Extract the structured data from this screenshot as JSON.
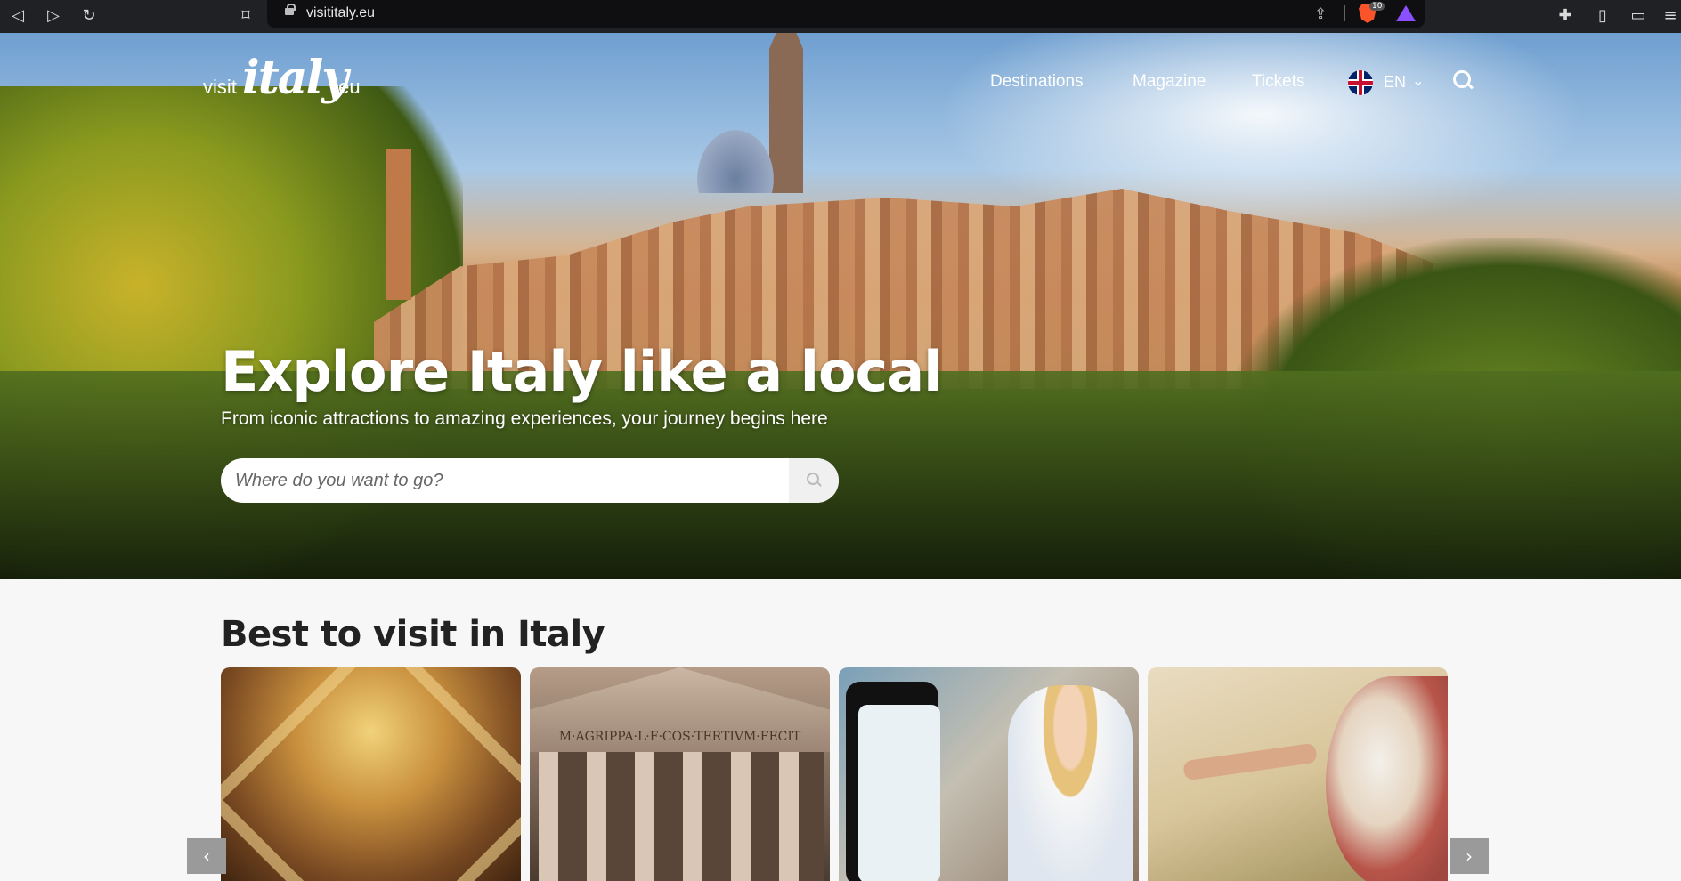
{
  "browser": {
    "url": "visititaly.eu",
    "extension_badge": "10"
  },
  "header": {
    "logo": {
      "pre": "visit",
      "main": "italy",
      "post": ".eu"
    },
    "menu": [
      {
        "label": "Destinations"
      },
      {
        "label": "Magazine"
      },
      {
        "label": "Tickets"
      }
    ],
    "language": {
      "code": "EN"
    }
  },
  "hero": {
    "headline": "Explore Italy like a local",
    "subline": "From iconic attractions to amazing experiences, your journey begins here",
    "search": {
      "placeholder": "Where do you want to go?"
    }
  },
  "section": {
    "title": "Best to visit in Italy",
    "cards": [
      {
        "name": "card-vatican-ceiling"
      },
      {
        "name": "card-pantheon",
        "inscription": "M·AGRIPPA·L·F·COS·TERTIVM·FECIT"
      },
      {
        "name": "card-app-traveller"
      },
      {
        "name": "card-creation-of-adam"
      }
    ]
  }
}
